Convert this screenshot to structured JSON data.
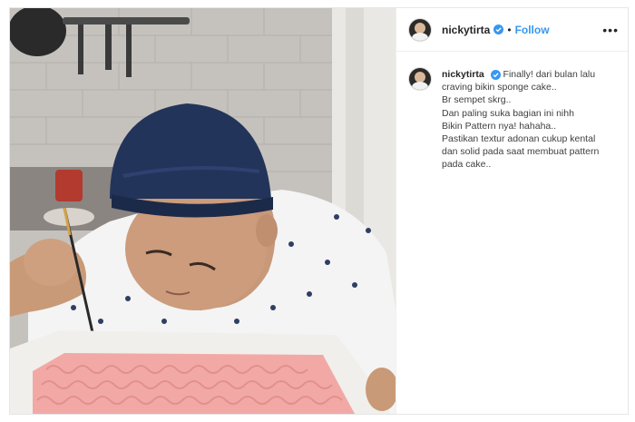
{
  "post": {
    "username": "nickytirta",
    "separator": "•",
    "follow_label": "Follow",
    "more_label": "•••",
    "verified_icon": "verified-badge-icon",
    "accent_color": "#3897f0"
  },
  "caption": {
    "username": "nickytirta",
    "text": "Finally! dari bulan lalu\ncraving bikin sponge cake..\nBr sempet skrg..\nDan paling suka bagian ini nihh\nBikin Pattern nya! hahaha..\nPastikan textur adonan cukup kental\ndan solid pada saat membuat pattern\npada cake.."
  }
}
